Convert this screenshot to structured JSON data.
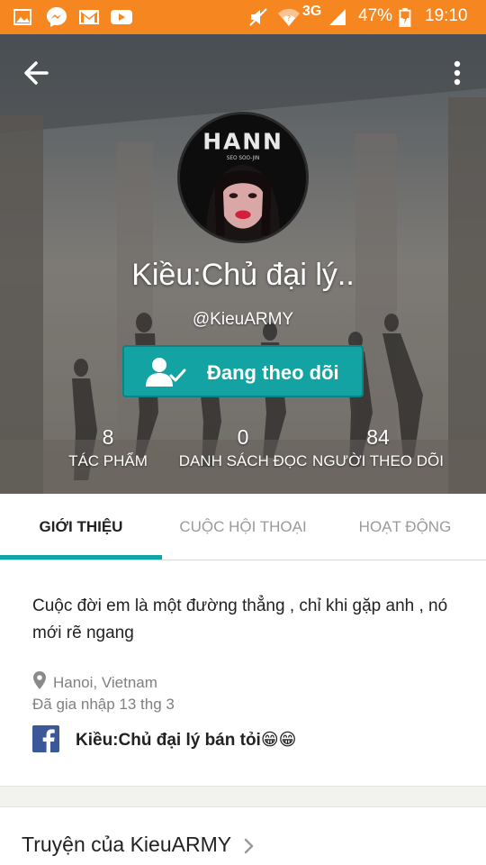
{
  "status_bar": {
    "carrier": "3G",
    "battery": "47%",
    "time": "19:10",
    "icons": [
      "gallery-icon",
      "messenger-icon",
      "gmail-icon",
      "youtube-icon",
      "mute-icon",
      "wifi-icon",
      "signal-icon",
      "battery-icon"
    ]
  },
  "profile": {
    "display_name": "Kiều:Chủ đại lý..",
    "username": "@KieuARMY",
    "avatar_text": "HANN",
    "avatar_subtext": "SEO SOO-JIN",
    "follow_label": "Đang theo dõi",
    "stats": [
      {
        "value": "8",
        "label": "TÁC PHẨM"
      },
      {
        "value": "0",
        "label": "DANH SÁCH ĐỌC"
      },
      {
        "value": "84",
        "label": "NGƯỜI THEO DÕI"
      }
    ]
  },
  "tabs": [
    {
      "label": "GIỚI THIỆU",
      "active": true
    },
    {
      "label": "CUỘC HỘI THOẠI",
      "active": false
    },
    {
      "label": "HOẠT ĐỘNG",
      "active": false
    }
  ],
  "about": {
    "bio": "Cuộc đời em là một đường thẳng , chỉ khi gặp anh , nó mới rẽ ngang",
    "location": "Hanoi, Vietnam",
    "joined": "Đã gia nhập 13 thg 3",
    "facebook_name": "Kiều:Chủ đại lý bán tỏi😁😁"
  },
  "stories": {
    "title": "Truyện của KieuARMY"
  },
  "colors": {
    "status_bar": "#f6861f",
    "accent": "#14a3a3",
    "facebook": "#3b5998"
  }
}
